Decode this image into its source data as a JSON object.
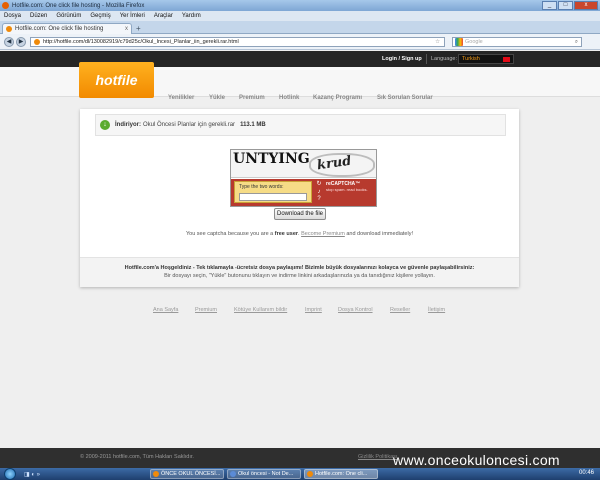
{
  "window": {
    "title": "Hotfile.com: One click file hosting - Mozilla Firefox",
    "controls": [
      "_",
      "□",
      "x"
    ]
  },
  "menu": [
    "Dosya",
    "Düzen",
    "Görünüm",
    "Geçmiş",
    "Yer İmleri",
    "Araçlar",
    "Yardım"
  ],
  "tab": {
    "title": "Hotfile.com: One click file hosting",
    "close": "x",
    "new": "+"
  },
  "nav": {
    "back": "◀",
    "forward": "▶",
    "url": "http://hotfile.com/dl/130082919/c79d25c/Okul_Incesi_Planlar_iin_gerekli.rar.html",
    "star": "☆",
    "search_placeholder": "Google",
    "search_icon": "search-icon"
  },
  "site": {
    "login": "Login / Sign up",
    "language_label": "Language:",
    "language_value": "Turkish",
    "logo": "hotfile",
    "menu": [
      "Yenilikler",
      "Yükle",
      "Premium",
      "Hotlink",
      "Kazanç Programı",
      "Sık Sorulan Sorular"
    ],
    "download": {
      "label": "İndiriyor:",
      "filename": "Okul Öncesi Planlar için gerekli.rar",
      "size": "113.1 MB"
    },
    "captcha": {
      "word1": "UNTYING",
      "word2": "krud",
      "instruction": "Type the two words:",
      "brand": "reCAPTCHA™",
      "tagline": "stop spam. read books."
    },
    "download_button": "Download the file",
    "note": {
      "part1": "You see captcha because you are a",
      "bold": "free user",
      "part2": ".",
      "link": "Become Premium",
      "part3": "and download immediately!"
    },
    "promo": {
      "line1": "Hotfile.com'a Hoşgeldiniz - Tek tıklamayla -ücretsiz dosya paylaşımı! Bizimle büyük dosyalarınızı kolayca ve güvenle paylaşabilirsiniz:",
      "line2": "Bir dosyayı seçin, \"Yükle\" butonunu tıklayın ve indirme linkini arkadaşlarınızla ya da tanıdığınız kişilere yollayın."
    },
    "footer_links": [
      "Ana Sayfa",
      "Premium",
      "Kötüye Kullanım bildir",
      "Imprint",
      "Dosya Kontrol",
      "Reseller",
      "İletişim"
    ],
    "copyright": "© 2009-2011 hotfile.com, Tüm Hakları Saklıdır.",
    "bottom_link": "Gizlilik Politikası"
  },
  "watermark": "www.onceokuloncesi.com",
  "taskbar": {
    "items": [
      "ÖNCE OKUL ÖNCESİ...",
      "Okul öncesi - Not De...",
      "Hotfile.com: One cli..."
    ],
    "clock": "00:46"
  },
  "colors": {
    "accent": "#f28a00",
    "dark_bar": "#252525",
    "download_icon": "#5aab2e",
    "recaptcha": "#b73a2e"
  }
}
